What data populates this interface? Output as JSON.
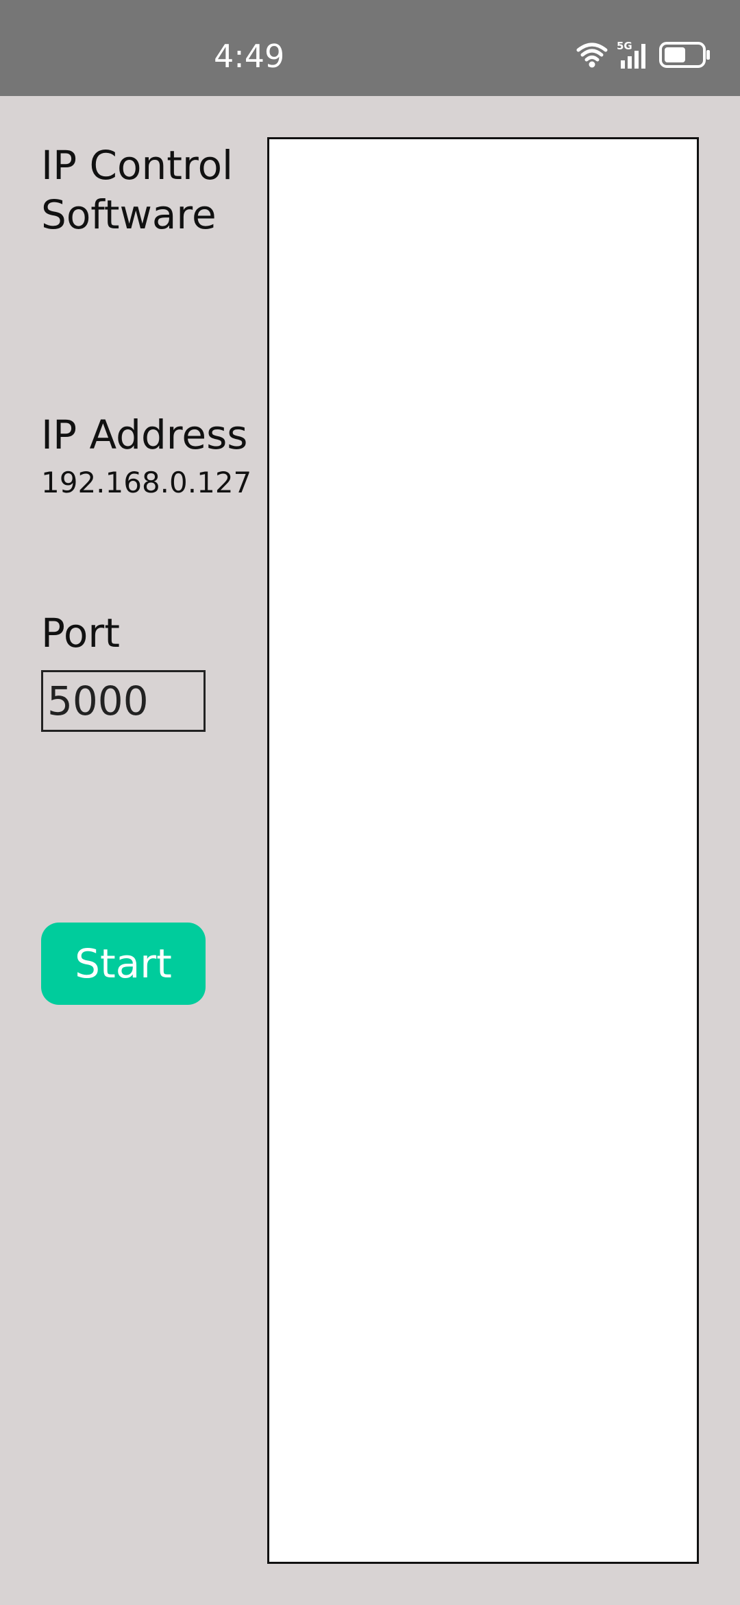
{
  "status_bar": {
    "time": "4:49",
    "network": "5G",
    "icons": [
      "wifi-icon",
      "cellular-signal-icon",
      "battery-icon"
    ]
  },
  "main": {
    "title": "IP Control Software",
    "ip_address_label": "IP Address",
    "ip_address_value": "192.168.0.127",
    "port_label": "Port",
    "port_value": "5000",
    "start_label": "Start",
    "output_text": ""
  },
  "colors": {
    "status_bar_bg": "#767676",
    "page_bg": "#d8d3d3",
    "accent": "#00cc9c",
    "output_bg": "#ffffff"
  }
}
